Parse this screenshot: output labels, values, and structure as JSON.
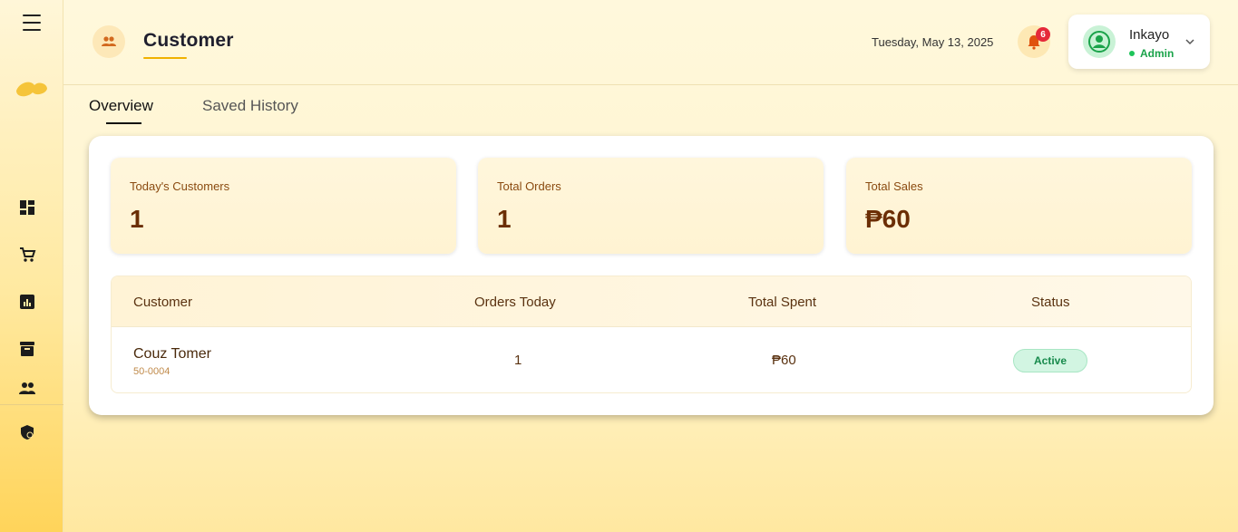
{
  "sidebar": {
    "nav": [
      "dashboard-icon",
      "cart-icon",
      "reports-icon",
      "archive-icon",
      "customers-icon",
      "security-icon"
    ]
  },
  "header": {
    "title": "Customer",
    "date": "Tuesday, May 13, 2025",
    "notifications_count": "6",
    "user": {
      "name": "Inkayo",
      "role": "Admin"
    }
  },
  "tabs": [
    {
      "label": "Overview",
      "active": true
    },
    {
      "label": "Saved History",
      "active": false
    }
  ],
  "stats": [
    {
      "label": "Today's Customers",
      "value": "1"
    },
    {
      "label": "Total Orders",
      "value": "1"
    },
    {
      "label": "Total Sales",
      "value": "₱60"
    }
  ],
  "table": {
    "columns": [
      "Customer",
      "Orders Today",
      "Total Spent",
      "Status"
    ],
    "rows": [
      {
        "name": "Couz Tomer",
        "id": "50-0004",
        "orders_today": "1",
        "total_spent": "₱60",
        "status": "Active"
      }
    ]
  },
  "colors": {
    "accent": "#f0b100",
    "status_active": "#178a4c",
    "badge": "#e5293a"
  }
}
